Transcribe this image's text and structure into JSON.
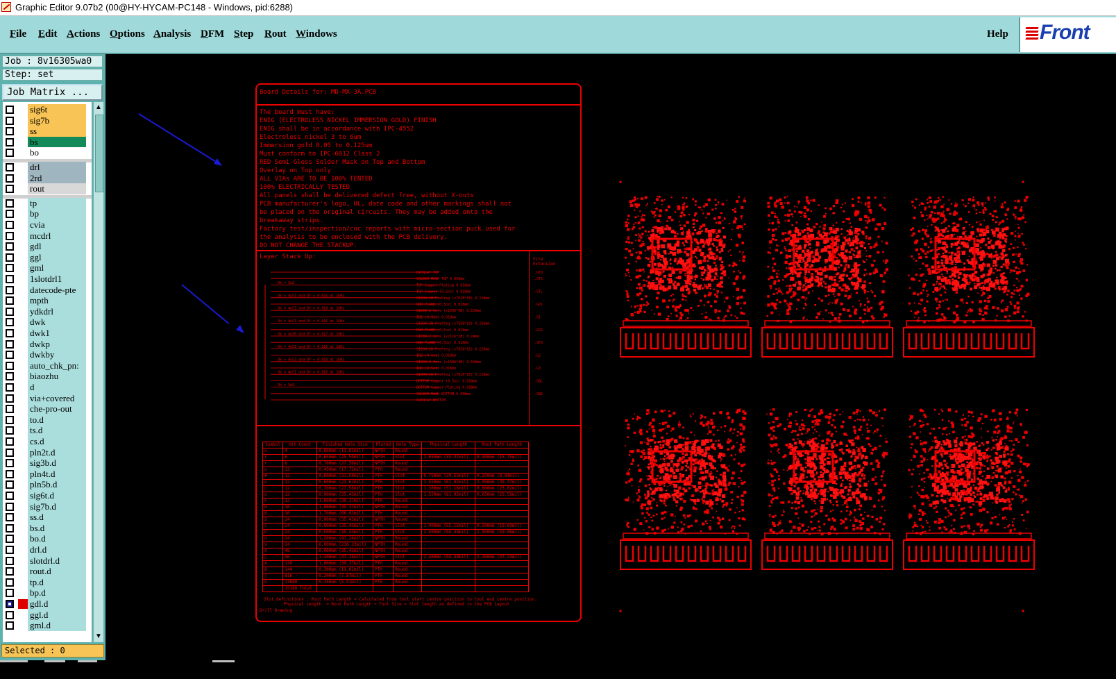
{
  "window": {
    "title": "Graphic Editor 9.07b2 (00@HY-HYCAM-PC148 - Windows, pid:6288)"
  },
  "menu": {
    "items": [
      {
        "first": "F",
        "rest": "ile"
      },
      {
        "first": "E",
        "rest": "dit"
      },
      {
        "first": "A",
        "rest": "ctions"
      },
      {
        "first": "O",
        "rest": "ptions"
      },
      {
        "first": "A",
        "rest": "nalysis"
      },
      {
        "first": "D",
        "rest": "FM"
      },
      {
        "first": "S",
        "rest": "tep"
      },
      {
        "first": "R",
        "rest": "out"
      },
      {
        "first": "W",
        "rest": "indows"
      }
    ],
    "help": "Help",
    "logo": "Front"
  },
  "panel": {
    "job": "Job : 8v16305wa0",
    "step": "Step: set",
    "job_matrix": "Job Matrix ...",
    "selected": "Selected : 0"
  },
  "layers": [
    {
      "name": "sig6t",
      "color": "#f8c455",
      "active": false,
      "mark": ""
    },
    {
      "name": "sig7b",
      "color": "#f8c455",
      "active": false,
      "mark": ""
    },
    {
      "name": "ss",
      "color": "#f8c455",
      "active": false,
      "mark": ""
    },
    {
      "name": "bs",
      "color": "#138a5a",
      "active": false,
      "mark": ""
    },
    {
      "name": "bo",
      "color": "#ffffff",
      "active": false,
      "mark": ""
    },
    {
      "name": "drl",
      "color": "#9fb5bf",
      "active": false,
      "mark": ""
    },
    {
      "name": "2rd",
      "color": "#9fb5bf",
      "active": false,
      "mark": ""
    },
    {
      "name": "rout",
      "color": "#d8d8d8",
      "active": false,
      "mark": ""
    },
    {
      "name": "tp",
      "color": "#a9dedd",
      "active": false,
      "mark": ""
    },
    {
      "name": "bp",
      "color": "#a9dedd",
      "active": false,
      "mark": ""
    },
    {
      "name": "cvia",
      "color": "#a9dedd",
      "active": false,
      "mark": ""
    },
    {
      "name": "mcdrl",
      "color": "#a9dedd",
      "active": false,
      "mark": ""
    },
    {
      "name": "gdl",
      "color": "#a9dedd",
      "active": false,
      "mark": ""
    },
    {
      "name": "ggl",
      "color": "#a9dedd",
      "active": false,
      "mark": ""
    },
    {
      "name": "gml",
      "color": "#a9dedd",
      "active": false,
      "mark": ""
    },
    {
      "name": "1slotdrl1",
      "color": "#a9dedd",
      "active": false,
      "mark": ""
    },
    {
      "name": "datecode-pte",
      "color": "#a9dedd",
      "active": false,
      "mark": ""
    },
    {
      "name": "mpth",
      "color": "#a9dedd",
      "active": false,
      "mark": ""
    },
    {
      "name": "ydkdrl",
      "color": "#a9dedd",
      "active": false,
      "mark": ""
    },
    {
      "name": "dwk",
      "color": "#a9dedd",
      "active": false,
      "mark": ""
    },
    {
      "name": "dwk1",
      "color": "#a9dedd",
      "active": false,
      "mark": ""
    },
    {
      "name": "dwkp",
      "color": "#a9dedd",
      "active": false,
      "mark": ""
    },
    {
      "name": "dwkby",
      "color": "#a9dedd",
      "active": false,
      "mark": ""
    },
    {
      "name": "auto_chk_pn:",
      "color": "#a9dedd",
      "active": false,
      "mark": ""
    },
    {
      "name": "biaozhu",
      "color": "#a9dedd",
      "active": false,
      "mark": ""
    },
    {
      "name": "d",
      "color": "#a9dedd",
      "active": false,
      "mark": ""
    },
    {
      "name": "via+covered",
      "color": "#a9dedd",
      "active": false,
      "mark": ""
    },
    {
      "name": "che-pro-out",
      "color": "#a9dedd",
      "active": false,
      "mark": ""
    },
    {
      "name": "to.d",
      "color": "#a9dedd",
      "active": false,
      "mark": ""
    },
    {
      "name": "ts.d",
      "color": "#a9dedd",
      "active": false,
      "mark": ""
    },
    {
      "name": "cs.d",
      "color": "#a9dedd",
      "active": false,
      "mark": "⇙"
    },
    {
      "name": "pln2t.d",
      "color": "#a9dedd",
      "active": false,
      "mark": "⇙"
    },
    {
      "name": "sig3b.d",
      "color": "#a9dedd",
      "active": false,
      "mark": "⇙"
    },
    {
      "name": "pln4t.d",
      "color": "#a9dedd",
      "active": false,
      "mark": "⇙"
    },
    {
      "name": "pln5b.d",
      "color": "#a9dedd",
      "active": false,
      "mark": "⇙"
    },
    {
      "name": "sig6t.d",
      "color": "#a9dedd",
      "active": false,
      "mark": "⇙"
    },
    {
      "name": "sig7b.d",
      "color": "#a9dedd",
      "active": false,
      "mark": "⇙"
    },
    {
      "name": "ss.d",
      "color": "#a9dedd",
      "active": false,
      "mark": ""
    },
    {
      "name": "bs.d",
      "color": "#a9dedd",
      "active": false,
      "mark": ""
    },
    {
      "name": "bo.d",
      "color": "#a9dedd",
      "active": false,
      "mark": ""
    },
    {
      "name": "drl.d",
      "color": "#a9dedd",
      "active": false,
      "mark": ""
    },
    {
      "name": "slotdrl.d",
      "color": "#a9dedd",
      "active": false,
      "mark": ""
    },
    {
      "name": "rout.d",
      "color": "#a9dedd",
      "active": false,
      "mark": ""
    },
    {
      "name": "tp.d",
      "color": "#a9dedd",
      "active": false,
      "mark": "⇙"
    },
    {
      "name": "bp.d",
      "color": "#a9dedd",
      "active": false,
      "mark": "⇙"
    },
    {
      "name": "gdl.d",
      "color": "#a9dedd",
      "active": true,
      "mark": "⇙⊞"
    },
    {
      "name": "ggl.d",
      "color": "#a9dedd",
      "active": false,
      "mark": ""
    },
    {
      "name": "gml.d",
      "color": "#a9dedd",
      "active": false,
      "mark": "⇙"
    }
  ],
  "board": {
    "title": "Board Details for: MD-MX-3A.PCB",
    "notes": [
      "The board must have:",
      "ENIG (ELECTROLESS NICKEL IMMERSION GOLD) FINISH",
      "ENIG shall be in accordance with IPC-4552",
      "Electroless nickel 3 to 6um",
      "Immersion gold 0.05 to 0.125um",
      "Must conform to IPC-6012 Class 2",
      "RED Semi-Gloss Solder Mask on Top and Bottom",
      "Overlay on Top only",
      "ALL VIAs ARE TO BE 100% TENTED",
      "100% ELECTRICALLY TESTED",
      "All panels shall be delivered defect free, without X-outs",
      "PCB manufacturer's logo, UL, date code and other markings shall not",
      "be placed on the original circuits. They may be added onto the",
      "breakaway strips.",
      "Factory test/inspection/coc reports with micro-section puck used for",
      "the analysis to be enclosed with the PCB delivery.",
      "DO NOT CHANGE THE STACKUP."
    ],
    "stack_title": "Layer Stack Up:",
    "stack_ext_header": "File\nExtension",
    "stack_rows": [
      {
        "left": "",
        "right": "OVERLAY TOP",
        "ext": ".GTO"
      },
      {
        "left": "",
        "right": "SOLDER MASK TOP 0.008mm",
        "ext": ".GTS"
      },
      {
        "left": "Dk = 3u6",
        "right": "TOP Copper Plating 0.018mm",
        "ext": ""
      },
      {
        "left": "",
        "right": "TOP Copper (0.5oz) 0.018mm",
        "ext": ".GTL"
      },
      {
        "left": "Dk = 4u51 and Df = 0.016 at 1GHz",
        "right": "S1000-2B PrePreg (x7628*1B) 0.226mm",
        "ext": ""
      },
      {
        "left": "",
        "right": "GND PLANE (0.5oz) 0.018mm",
        "ext": ".GP1"
      },
      {
        "left": "Dk = 4u53 and Df = 0.018 at 1GHz",
        "right": "S1000-2 Core (x1506*4B) 0.150mm",
        "ext": ""
      },
      {
        "left": "",
        "right": "IN1 (0.5oz) 0.018mm",
        "ext": ".G1"
      },
      {
        "left": "Dk = 4u51 and Df = 0.016 at 1GHz",
        "right": "S1000-2B PrePreg (x7628*1B) 0.226mm",
        "ext": ""
      },
      {
        "left": "",
        "right": "PWR PLANE (0.5oz) 0.018mm",
        "ext": ".GP2"
      },
      {
        "left": "Dk = 4u36 and Df = 0.017 at 1GHz",
        "right": "S1000-2 Core (x2116*2B) 0.24mm",
        "ext": ""
      },
      {
        "left": "",
        "right": "GND PLANE (0.5oz) 0.018mm",
        "ext": ".GP3"
      },
      {
        "left": "Dk = 4u51 and Df = 0.016 at 1GHz",
        "right": "S1000-2B PrePreg (x7628*1B) 0.226mm",
        "ext": ""
      },
      {
        "left": "",
        "right": "IN2 (0.5oz) 0.018mm",
        "ext": ".G2"
      },
      {
        "left": "Dk = 4u53 and Df = 0.018 at 1GHz",
        "right": "S1000-2 Core (x1506*4B) 0.150mm",
        "ext": ""
      },
      {
        "left": "",
        "right": "IN3 (0.5oz) 0.018mm",
        "ext": ".G3"
      },
      {
        "left": "Dk = 4u51 and Df = 0.016 at 1GHz",
        "right": "S1000-2B PrePreg (x7628*1B) 0.226mm",
        "ext": ""
      },
      {
        "left": "",
        "right": "BOTTOM Copper (0.5oz) 0.018mm",
        "ext": ".GBL"
      },
      {
        "left": "Dk = 3u6",
        "right": "BOTTOM Copper Plating 0.018mm",
        "ext": ""
      },
      {
        "left": "",
        "right": "SOLDER MASK BOTTOM 0.008mm",
        "ext": ".GBS"
      },
      {
        "left": "",
        "right": "OVERLAY BOTTOM",
        "ext": ""
      }
    ],
    "drill_headers": [
      "Symbol",
      "Hit Count",
      "Finished Hole Size",
      "Plated",
      "Hole Type",
      "Physical Length",
      "Rout Path Length"
    ],
    "drill_rows": [
      [
        "x",
        "4",
        "0.800mm (11.81mil)",
        "NPTH",
        "Round",
        "-",
        "-"
      ],
      [
        "Y",
        "6",
        "0.650mm (25.59mil)",
        "NPTH",
        "Slot",
        "1.050mm (35.37mil)",
        "0.400mm (15.75mil)"
      ],
      [
        "+",
        "6",
        "0.700mm (27.56mil)",
        "NPTH",
        "Round",
        "-",
        "-"
      ],
      [
        "o",
        "12",
        "0.450mm (17.72mil)",
        "PTH",
        "Round",
        "-",
        "-"
      ],
      [
        "#",
        "12",
        "0.800mm (31.50mil)",
        "PTH",
        "Slot",
        "0.750mm (29.53mil)",
        "0.250mm (9.84mil)"
      ],
      [
        "o",
        "12",
        "0.600mm (23.62mil)",
        "PTH",
        "Slot",
        "1.550mm (61.02mil)",
        "1.000mm (39.37mil)"
      ],
      [
        "□",
        "12",
        "0.700mm (27.56mil)",
        "PTH",
        "Slot",
        "1.300mm (51.18mil)",
        "0.600mm (23.62mil)"
      ],
      [
        "o",
        "12",
        "0.900mm (35.43mil)",
        "PTH",
        "Slot",
        "1.550mm (61.02mil)",
        "0.650mm (25.59mil)"
      ],
      [
        "F",
        "12",
        "1.000mm (39.37mil)",
        "PTH",
        "Round",
        "-",
        "-"
      ],
      [
        "H",
        "10",
        "1.000mm (39.37mil)",
        "NPTH",
        "Round",
        "-",
        "-"
      ],
      [
        "B",
        "10",
        "1.700mm (66.93mil)",
        "PTH",
        "Round",
        "-",
        "-"
      ],
      [
        "Z",
        "24",
        "0.900mm (35.43mil)",
        "NPTH",
        "Round",
        "-",
        "-"
      ],
      [
        "C",
        "24",
        "0.900mm (35.43mil)",
        "PTH",
        "Slot",
        "1.400mm (55.12mil)",
        "0.500mm (19.69mil)"
      ],
      [
        "D",
        "24",
        "0.900mm (35.43mil)",
        "PTH",
        "Slot",
        "2.400mm (94.49mil)",
        "1.500mm (59.06mil)"
      ],
      [
        "G",
        "24",
        "1.200mm (47.24mil)",
        "NPTH",
        "Round",
        "-",
        "-"
      ],
      [
        "V",
        "24",
        "6.000mm (236.22mil)",
        "NPTH",
        "Round",
        "-",
        "-"
      ],
      [
        "X",
        "48",
        "0.900mm (35.43mil)",
        "NPTH",
        "Round",
        "-",
        "-"
      ],
      [
        "□",
        "96",
        "1.200mm (47.24mil)",
        "NPTH",
        "Slot",
        "2.400mm (94.49mil)",
        "1.200mm (47.24mil)"
      ],
      [
        "A",
        "120",
        "1.000mm (39.37mil)",
        "PTH",
        "Round",
        "-",
        "-"
      ],
      [
        "Ø",
        "144",
        "0.300mm (11.81mil)",
        "PTH",
        "Round",
        "-",
        "-"
      ],
      [
        "◊",
        "816",
        "0.200mm (7.87mil)",
        "PTH",
        "Round",
        "-",
        "-"
      ],
      [
        "G",
        "13880",
        "0.150mm (5.91mil)",
        "PTH",
        "Round",
        "-",
        "-"
      ],
      [
        "",
        "15188 Total",
        "",
        "",
        "",
        "",
        ""
      ]
    ],
    "drill_note": "Slot definitions : Rout Path Length = Calculated from tool start centre position to tool end centre position.\n        Physical Length  = Rout Path Length + Tool Size = Slot length as defined in the PCB Layout",
    "drill_label": "Drill Drawing"
  }
}
